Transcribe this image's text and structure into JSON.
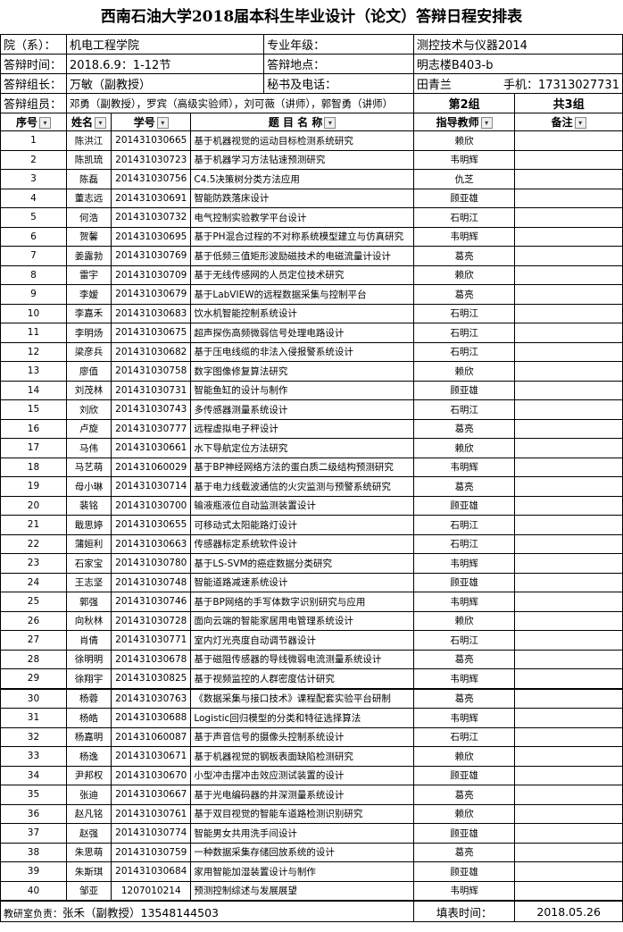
{
  "title": "西南石油大学2018届本科生毕业设计（论文）答辩日程安排表",
  "info": {
    "dept_label": "院（系）：",
    "dept_value": "机电工程学院",
    "major_label": "专业年级：",
    "major_value": "测控技术与仪器2014",
    "time_label": "答辩时间：",
    "time_value": "2018.6.9：1-12节",
    "place_label": "答辩地点：",
    "place_value": "明志楼B403-b",
    "leader_label": "答辩组长：",
    "leader_value": "万敏（副教授）",
    "secretary_label": "秘书及电话：",
    "secretary_value": "田青兰",
    "phone_label": "手机：",
    "phone_value": "17313027731",
    "members_label": "答辩组员：",
    "members_value": "邓勇（副教授），罗宾（高级实验师），刘可薇（讲师），郭智勇（讲师）",
    "group_value": "第2组",
    "total_value": "共3组"
  },
  "columns": {
    "no": "序号",
    "name": "姓名",
    "student_id": "学号",
    "topic": "题 目 名 称",
    "advisor": "指导教师",
    "note": "备注"
  },
  "rows": [
    {
      "no": "1",
      "name": "陈洪江",
      "id": "201431030665",
      "topic": "基于机器视觉的运动目标检测系统研究",
      "advisor": "赖欣"
    },
    {
      "no": "2",
      "name": "陈凯琉",
      "id": "201431030723",
      "topic": "基于机器学习方法钻速预测研究",
      "advisor": "韦明辉"
    },
    {
      "no": "3",
      "name": "陈磊",
      "id": "201431030756",
      "topic": "C4.5决策树分类方法应用",
      "advisor": "仇芝"
    },
    {
      "no": "4",
      "name": "董志远",
      "id": "201431030691",
      "topic": "智能防跌落床设计",
      "advisor": "顾亚雄"
    },
    {
      "no": "5",
      "name": "何浩",
      "id": "201431030732",
      "topic": "电气控制实验教学平台设计",
      "advisor": "石明江"
    },
    {
      "no": "6",
      "name": "贺馨",
      "id": "201431030695",
      "topic": "基于PH混合过程的不对称系统模型建立与仿真研究",
      "advisor": "韦明辉"
    },
    {
      "no": "7",
      "name": "姜露勃",
      "id": "201431030769",
      "topic": "基于低频三值矩形波励磁技术的电磁流量计设计",
      "advisor": "葛亮"
    },
    {
      "no": "8",
      "name": "雷宇",
      "id": "201431030709",
      "topic": "基于无线传感网的人员定位技术研究",
      "advisor": "赖欣"
    },
    {
      "no": "9",
      "name": "李嫒",
      "id": "201431030679",
      "topic": "基于LabVIEW的远程数据采集与控制平台",
      "advisor": "葛亮"
    },
    {
      "no": "10",
      "name": "李嘉禾",
      "id": "201431030683",
      "topic": "饮水机智能控制系统设计",
      "advisor": "石明江"
    },
    {
      "no": "11",
      "name": "李明炀",
      "id": "201431030675",
      "topic": "超声探伤高频微弱信号处理电路设计",
      "advisor": "石明江"
    },
    {
      "no": "12",
      "name": "梁彦兵",
      "id": "201431030682",
      "topic": "基于压电线缆的非法入侵报警系统设计",
      "advisor": "石明江"
    },
    {
      "no": "13",
      "name": "廖值",
      "id": "201431030758",
      "topic": "数字图像修复算法研究",
      "advisor": "赖欣"
    },
    {
      "no": "14",
      "name": "刘茂林",
      "id": "201431030731",
      "topic": "智能鱼缸的设计与制作",
      "advisor": "顾亚雄"
    },
    {
      "no": "15",
      "name": "刘欣",
      "id": "201431030743",
      "topic": "多传感器测量系统设计",
      "advisor": "石明江"
    },
    {
      "no": "16",
      "name": "卢旋",
      "id": "201431030777",
      "topic": "远程虚拟电子秤设计",
      "advisor": "葛亮"
    },
    {
      "no": "17",
      "name": "马伟",
      "id": "201431030661",
      "topic": "水下导航定位方法研究",
      "advisor": "赖欣"
    },
    {
      "no": "18",
      "name": "马艺萌",
      "id": "201431060029",
      "topic": "基于BP神经网络方法的蛋白质二级结构预测研究",
      "advisor": "韦明辉"
    },
    {
      "no": "19",
      "name": "母小琳",
      "id": "201431030714",
      "topic": "基于电力线载波通信的火灾监测与预警系统研究",
      "advisor": "葛亮"
    },
    {
      "no": "20",
      "name": "裴铭",
      "id": "201431030700",
      "topic": "输液瓶液位自动监测装置设计",
      "advisor": "顾亚雄"
    },
    {
      "no": "21",
      "name": "戢思婷",
      "id": "201431030655",
      "topic": "可移动式太阳能路灯设计",
      "advisor": "石明江"
    },
    {
      "no": "22",
      "name": "蒲姮利",
      "id": "201431030663",
      "topic": "传感器标定系统软件设计",
      "advisor": "石明江"
    },
    {
      "no": "23",
      "name": "石家宝",
      "id": "201431030780",
      "topic": "基于LS-SVM的癌症数据分类研究",
      "advisor": "韦明辉"
    },
    {
      "no": "24",
      "name": "王志坚",
      "id": "201431030748",
      "topic": "智能道路减速系统设计",
      "advisor": "顾亚雄"
    },
    {
      "no": "25",
      "name": "郭强",
      "id": "201431030746",
      "topic": "基于BP网络的手写体数字识别研究与应用",
      "advisor": "韦明辉"
    },
    {
      "no": "26",
      "name": "向秋林",
      "id": "201431030728",
      "topic": "面向云端的智能家居用电管理系统设计",
      "advisor": "赖欣"
    },
    {
      "no": "27",
      "name": "肖倩",
      "id": "201431030771",
      "topic": "室内灯光亮度自动调节器设计",
      "advisor": "石明江"
    },
    {
      "no": "28",
      "name": "徐明明",
      "id": "201431030678",
      "topic": "基于磁阻传感器的导线微弱电流测量系统设计",
      "advisor": "葛亮"
    },
    {
      "no": "29",
      "name": "徐翔宇",
      "id": "201431030825",
      "topic": "基于视频监控的人群密度估计研究",
      "advisor": "韦明辉"
    },
    {
      "no": "30",
      "name": "杨蓉",
      "id": "201431030763",
      "topic": "《数据采集与接口技术》课程配套实验平台研制",
      "advisor": "葛亮"
    },
    {
      "no": "31",
      "name": "杨皓",
      "id": "201431030688",
      "topic": "Logistic回归模型的分类和特征选择算法",
      "advisor": "韦明辉"
    },
    {
      "no": "32",
      "name": "杨嘉明",
      "id": "201431060087",
      "topic": "基于声音信号的摄像头控制系统设计",
      "advisor": "石明江"
    },
    {
      "no": "33",
      "name": "杨逸",
      "id": "201431030671",
      "topic": "基于机器视觉的钢板表面缺陷检测研究",
      "advisor": "赖欣"
    },
    {
      "no": "34",
      "name": "尹邦权",
      "id": "201431030670",
      "topic": "小型冲击摆冲击效应测试装置的设计",
      "advisor": "顾亚雄"
    },
    {
      "no": "35",
      "name": "张迪",
      "id": "201431030667",
      "topic": "基于光电编码器的井深测量系统设计",
      "advisor": "葛亮"
    },
    {
      "no": "36",
      "name": "赵凡铭",
      "id": "201431030761",
      "topic": "基于双目视觉的智能车道路检测识别研究",
      "advisor": "赖欣"
    },
    {
      "no": "37",
      "name": "赵强",
      "id": "201431030774",
      "topic": "智能男女共用洗手间设计",
      "advisor": "顾亚雄"
    },
    {
      "no": "38",
      "name": "朱思萌",
      "id": "201431030759",
      "topic": "一种数据采集存储回放系统的设计",
      "advisor": "葛亮"
    },
    {
      "no": "39",
      "name": "朱斯琪",
      "id": "201431030684",
      "topic": "家用智能加湿装置设计与制作",
      "advisor": "顾亚雄"
    },
    {
      "no": "40",
      "name": "邹亚",
      "id": "1207010214",
      "topic": "预测控制综述与发展展望",
      "advisor": "韦明辉"
    }
  ],
  "footer": {
    "head_label": "教研室负责：",
    "head_value": "张禾（副教授）13548144503",
    "date_label": "填表时间：",
    "date_value": "2018.05.26"
  }
}
